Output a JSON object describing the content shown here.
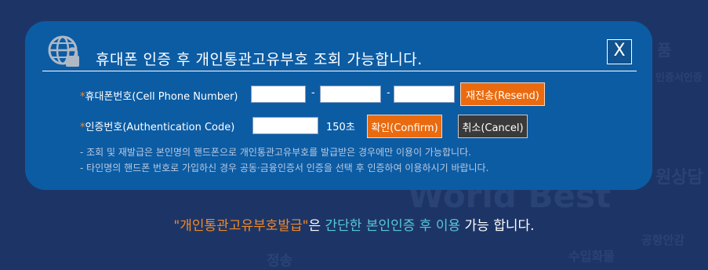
{
  "dialog": {
    "title": "휴대폰 인증 후 개인통관고유부호 조회 가능합니다.",
    "close_label": "X"
  },
  "phone": {
    "star": "*",
    "label": "휴대폰번호(Cell Phone Number)",
    "part1": "",
    "part2": "",
    "part3": "",
    "separator": "-",
    "resend_label": "재전송(Resend)"
  },
  "auth": {
    "star": "*",
    "label": "인증번호(Authentication Code)",
    "code": "",
    "timer": "150초",
    "confirm_label": "확인(Confirm)",
    "cancel_label": "취소(Cancel)"
  },
  "notes": [
    "- 조회 및 재발급은 본인명의 핸드폰으로 개인통관고유부호를 발급받은 경우에만 이용이 가능합니다.",
    "- 타인명의 핸드폰 번호로 가입하신 경우 공동·금융인증서 인증을 선택 후 인증하여 이용하시기 바랍니다."
  ],
  "bottom_message": {
    "part1": "\"개인통관고유부호발급\"",
    "part2": "은 ",
    "part3": "간단한 본인인증 후 이용",
    "part4": " 가능 합니다."
  },
  "colors": {
    "background": "#1d3566",
    "panel": "#0c5ca4",
    "accent_orange": "#ea6b0f",
    "accent_cyan": "#56c8d8"
  },
  "icons": {
    "header": "globe-lock-icon"
  }
}
